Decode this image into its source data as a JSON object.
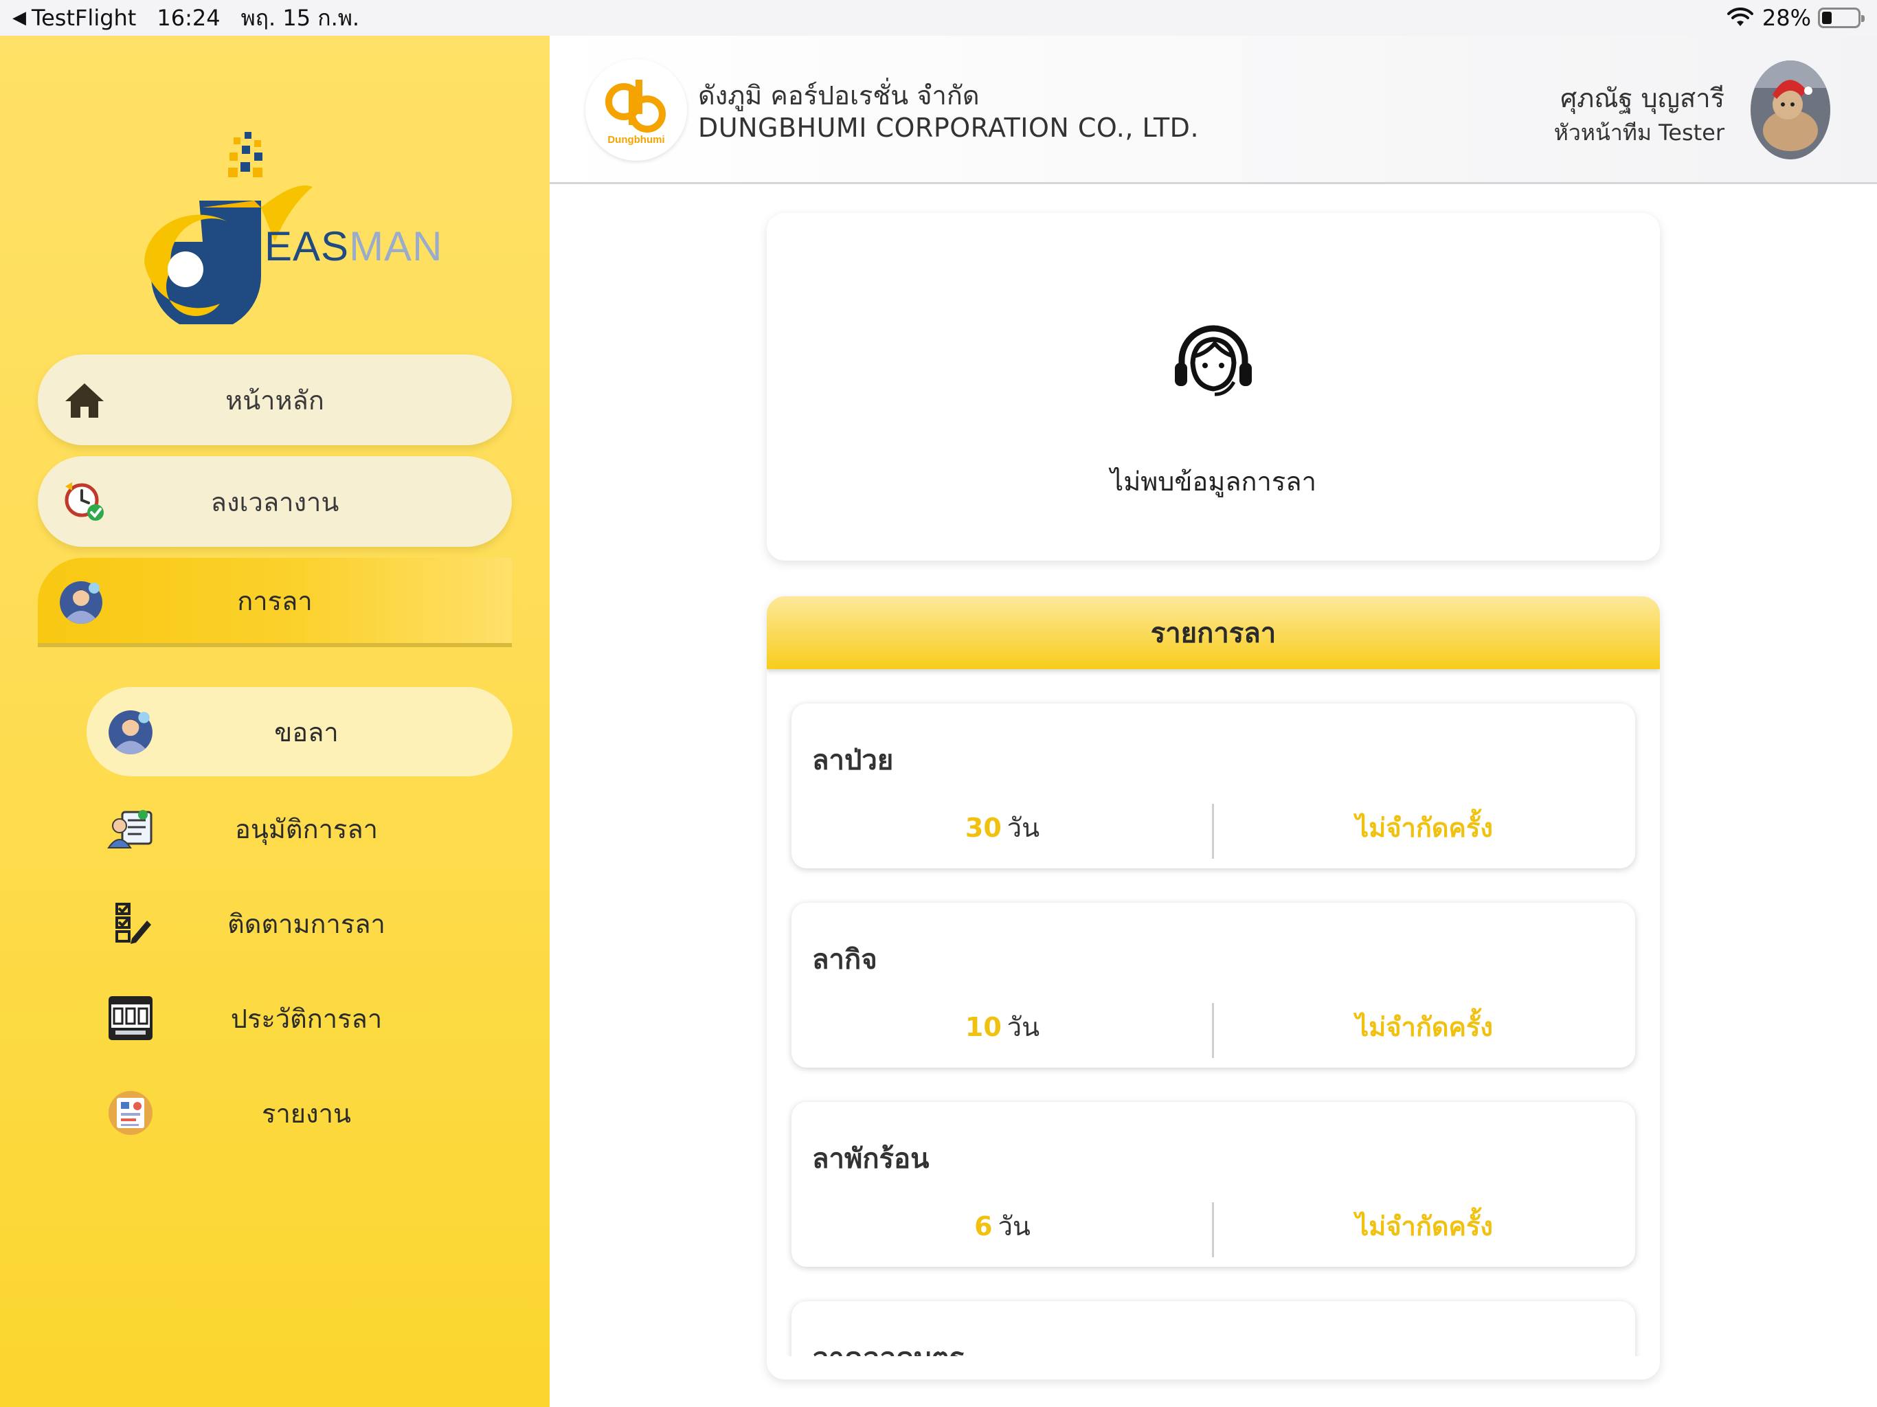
{
  "status_bar": {
    "back_arrow": "◀",
    "app": "TestFlight",
    "time": "16:24",
    "date": "พฤ. 15 ก.พ.",
    "battery": "28%",
    "battery_level": 0.28
  },
  "logo": {
    "part1": "EAS",
    "part2": "MAN"
  },
  "sidebar": {
    "home": "หน้าหลัก",
    "clock_in": "ลงเวลางาน",
    "leave": "การลา",
    "sub_items": {
      "request": "ขอลา",
      "approve": "อนุมัติการลา",
      "track": "ติดตามการลา",
      "history": "ประวัติการลา",
      "report": "รายงาน"
    }
  },
  "header": {
    "company_logo_text": "Dungbhumi",
    "company_th": "ดังภูมิ คอร์ปอเรชั่น จำกัด",
    "company_en": "DUNGBHUMI CORPORATION CO., LTD.",
    "user_name": "ศุภณัฐ บุญสารี",
    "user_role": "หัวหน้าทีม Tester"
  },
  "empty_state": {
    "message": "ไม่พบข้อมูลการลา"
  },
  "leave_list": {
    "title": "รายการลา",
    "day_unit": "วัน",
    "items": [
      {
        "name": "ลาป่วย",
        "days": "30",
        "limit": "ไม่จำกัดครั้ง"
      },
      {
        "name": "ลากิจ",
        "days": "10",
        "limit": "ไม่จำกัดครั้ง"
      },
      {
        "name": "ลาพักร้อน",
        "days": "6",
        "limit": "ไม่จำกัดครั้ง"
      },
      {
        "name": "ลาคลอดบุตร",
        "days": "",
        "limit": ""
      }
    ]
  },
  "colors": {
    "accent": "#f0c10e",
    "sidebar_top": "#ffe167",
    "sidebar_bottom": "#fbd62e",
    "logo_blue": "#1f4a82"
  },
  "icons": {
    "home": "home-icon",
    "clock": "clock-check-icon",
    "leave": "person-avatar-icon",
    "approve": "approve-document-icon",
    "track": "checklist-pen-icon",
    "history": "history-board-icon",
    "report": "report-icon",
    "support": "headset-support-icon"
  }
}
